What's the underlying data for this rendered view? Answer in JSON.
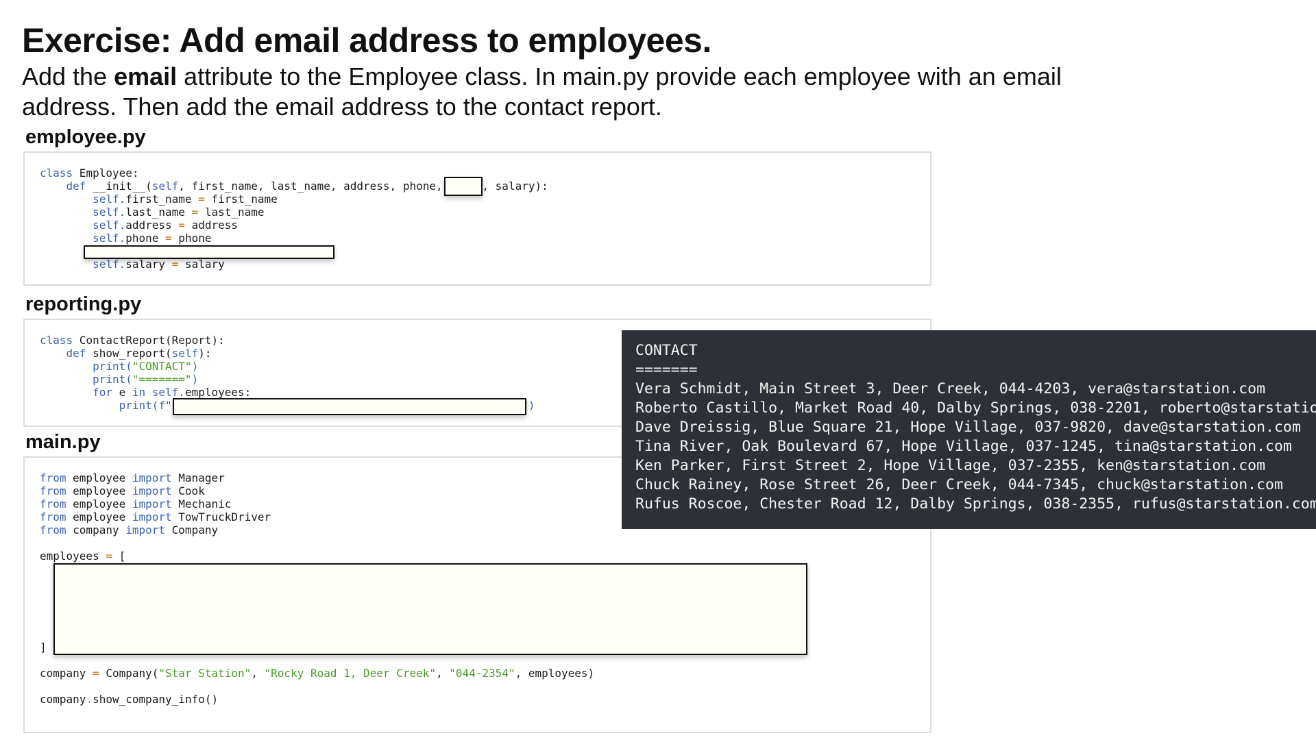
{
  "heading": {
    "title": "Exercise: Add email address to employees.",
    "instruction_pre": "Add the ",
    "instruction_bold": "email",
    "instruction_post": " attribute to the Employee class. In main.py provide each employee with an email address. Then add the email address to the contact report."
  },
  "files": {
    "employee": {
      "label": "employee.py",
      "code": {
        "class_kw": "class",
        "class_name": " Employee:",
        "def_kw": "def",
        "init_pre": " __init__(",
        "self_kw": "self",
        "init_params": ", first_name, last_name, address, phone,",
        "init_post": ", salary):",
        "self_prefix": "self.",
        "eq": "=",
        "assign_first_name_lhs": "first_name ",
        "assign_first_name_rhs": " first_name",
        "assign_last_name_lhs": "last_name ",
        "assign_last_name_rhs": " last_name",
        "assign_address_lhs": "address ",
        "assign_address_rhs": " address",
        "assign_phone_lhs": "phone ",
        "assign_phone_rhs": " phone",
        "assign_salary_lhs": "salary ",
        "assign_salary_rhs": " salary"
      }
    },
    "reporting": {
      "label": "reporting.py",
      "code": {
        "class_kw": "class",
        "class_decl": " ContactReport(Report):",
        "def_kw": "def",
        "def_name": " show_report(",
        "self_kw": "self",
        "def_close": "):",
        "print_fn": "print(",
        "str_contact": "\"CONTACT\"",
        "str_equals": "\"=======\"",
        "close_paren": ")",
        "for_kw": "for",
        "for_var": " e ",
        "in_kw": "in",
        "self_dot": " self.",
        "for_tail": "employees:",
        "print_f_prefix": "print(f\"",
        "print_f_close_quote": "\"",
        "print_f_close_paren": ")"
      }
    },
    "main": {
      "label": "main.py",
      "code": {
        "from_kw": "from",
        "import_kw": "import",
        "mod_employee": " employee ",
        "mod_company": " company ",
        "cls_manager": " Manager",
        "cls_cook": " Cook",
        "cls_mechanic": " Mechanic",
        "cls_towtruck": " TowTruckDriver",
        "cls_company": " Company",
        "employees_lhs": "employees ",
        "eq": "=",
        "open_bracket": " [",
        "close_bracket": "]",
        "company_lhs": "company ",
        "company_ctor": " Company(",
        "arg_name": "\"Star Station\"",
        "arg_addr": "\"Rocky Road 1, Deer Creek\"",
        "arg_phone": "\"044-2354\"",
        "comma": ", ",
        "company_tail": ", employees)",
        "call_obj": "company",
        "dot": ".",
        "call_method": "show_company_info()"
      }
    }
  },
  "terminal": {
    "header": "CONTACT",
    "separator": "=======",
    "lines": [
      "Vera Schmidt, Main Street 3, Deer Creek, 044-4203, vera@starstation.com",
      "Roberto Castillo, Market Road 40, Dalby Springs, 038-2201, roberto@starstation.",
      "Dave Dreissig, Blue Square 21, Hope Village, 037-9820, dave@starstation.com",
      "Tina River, Oak Boulevard 67, Hope Village, 037-1245, tina@starstation.com",
      "Ken Parker, First Street 2, Hope Village, 037-2355, ken@starstation.com",
      "Chuck Rainey, Rose Street 26, Deer Creek, 044-7345, chuck@starstation.com",
      "Rufus Roscoe, Chester Road 12, Dalby Springs, 038-2355, rufus@starstation.com"
    ]
  },
  "colors": {
    "keyword": "#3b63b0",
    "operator": "#c47a1e",
    "string": "#4a9a2a",
    "terminal_bg": "#2d3137",
    "blank_fill": "#fffff7"
  }
}
